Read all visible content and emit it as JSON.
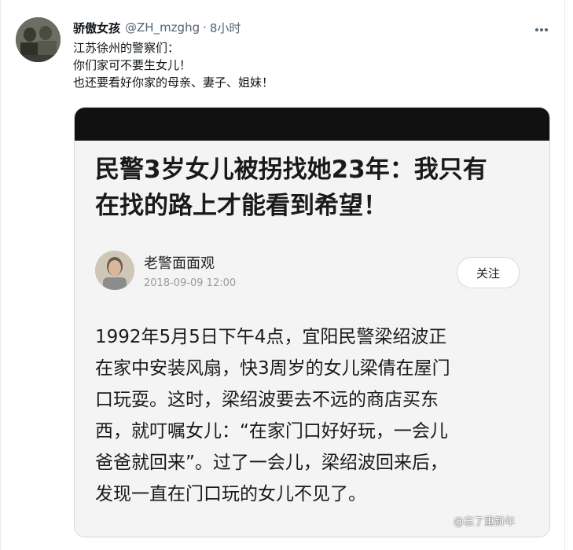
{
  "tweet": {
    "display_name": "骄傲女孩",
    "handle": "@ZH_mzghg",
    "separator": "·",
    "time": "8小时",
    "more_icon": "ellipsis-icon",
    "text_lines": [
      "江苏徐州的警察们：",
      "你们家可不要生女儿！",
      "也还要看好你家的母亲、妻子、姐妹！"
    ]
  },
  "article": {
    "headline_lines": [
      "民警3岁女儿被拐找她23年：我只有",
      "在找的路上才能看到希望！"
    ],
    "author": "老警面面观",
    "date": "2018-09-09 12:00",
    "follow_label": "关注",
    "body_lines": [
      "1992年5月5日下午4点，宜阳民警梁绍波正",
      "在家中安装风扇，快3周岁的女儿梁倩在屋门",
      "口玩耍。这时，梁绍波要去不远的商店买东",
      "西，就叮嘱女儿：“在家门口好好玩，一会儿",
      "爸爸就回来”。过了一会儿，梁绍波回来后，",
      "发现一直在门口玩的女儿不见了。"
    ],
    "watermark": "@忘了重新年"
  },
  "colors": {
    "text": "#0f1419",
    "secondary": "#536471",
    "media_border": "#cfd9de",
    "topbar": "#111111"
  }
}
